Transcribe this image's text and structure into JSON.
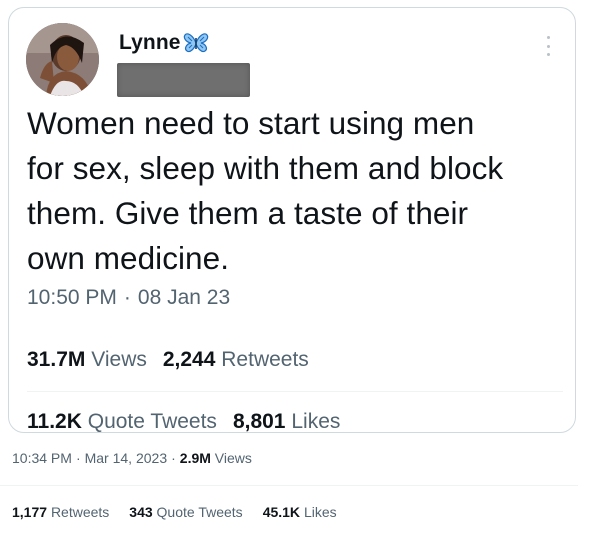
{
  "tweet_card": {
    "display_name": "Lynne",
    "name_emoji_icon": "butterfly-icon",
    "text_lines": [
      "Women need to start using men",
      "for sex, sleep with them and block",
      "them. Give them a taste of their",
      "own medicine."
    ],
    "time": "10:50 PM",
    "separator": "·",
    "date": "08 Jan 23",
    "views_count": "31.7M",
    "views_label": "Views",
    "retweets_count": "2,244",
    "retweets_label": "Retweets",
    "quotes_count": "11.2K",
    "quotes_label": "Quote Tweets",
    "likes_count": "8,801",
    "likes_label": "Likes"
  },
  "outer_tweet": {
    "time": "10:34 PM",
    "separator": "·",
    "date": "Mar 14, 2023",
    "views_count": "2.9M",
    "views_label": "Views",
    "retweets_count": "1,177",
    "retweets_label": "Retweets",
    "quotes_count": "343",
    "quotes_label": "Quote Tweets",
    "likes_count": "45.1K",
    "likes_label": "Likes"
  },
  "colors": {
    "text_primary": "#0f1419",
    "text_secondary": "#536471",
    "border": "#cfd9de",
    "butterfly": "#1d9bf0"
  }
}
